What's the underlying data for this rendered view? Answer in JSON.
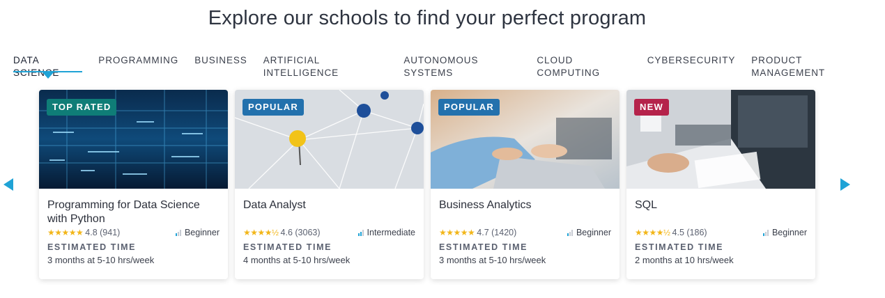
{
  "heading": "Explore our schools to find your perfect program",
  "tabs": [
    {
      "label": "DATA SCIENCE",
      "active": true
    },
    {
      "label": "PROGRAMMING"
    },
    {
      "label": "BUSINESS"
    },
    {
      "label": "ARTIFICIAL INTELLIGENCE"
    },
    {
      "label": "AUTONOMOUS SYSTEMS"
    },
    {
      "label": "CLOUD COMPUTING"
    },
    {
      "label": "CYBERSECURITY"
    },
    {
      "label": "PRODUCT MANAGEMENT"
    }
  ],
  "colors": {
    "accent": "#1fa3d6",
    "star": "#f2b619",
    "top_rated": "#0f7d77",
    "popular": "#2371ad",
    "new": "#b5234b"
  },
  "cards": [
    {
      "badge": "TOP RATED",
      "title": "Programming for Data Science with Python",
      "stars": "★★★★★",
      "rating": "4.8 (941)",
      "level": "Beginner",
      "level_bars": 1,
      "est_label": "ESTIMATED TIME",
      "duration": "3 months at 5-10 hrs/week"
    },
    {
      "badge": "POPULAR",
      "title": "Data Analyst",
      "stars": "★★★★½",
      "rating": "4.6 (3063)",
      "level": "Intermediate",
      "level_bars": 2,
      "est_label": "ESTIMATED TIME",
      "duration": "4 months at 5-10 hrs/week"
    },
    {
      "badge": "POPULAR",
      "title": "Business Analytics",
      "stars": "★★★★★",
      "rating": "4.7 (1420)",
      "level": "Beginner",
      "level_bars": 1,
      "est_label": "ESTIMATED TIME",
      "duration": "3 months at 5-10 hrs/week"
    },
    {
      "badge": "NEW",
      "title": "SQL",
      "stars": "★★★★½",
      "rating": "4.5 (186)",
      "level": "Beginner",
      "level_bars": 1,
      "est_label": "ESTIMATED TIME",
      "duration": "2 months at 10 hrs/week"
    }
  ]
}
